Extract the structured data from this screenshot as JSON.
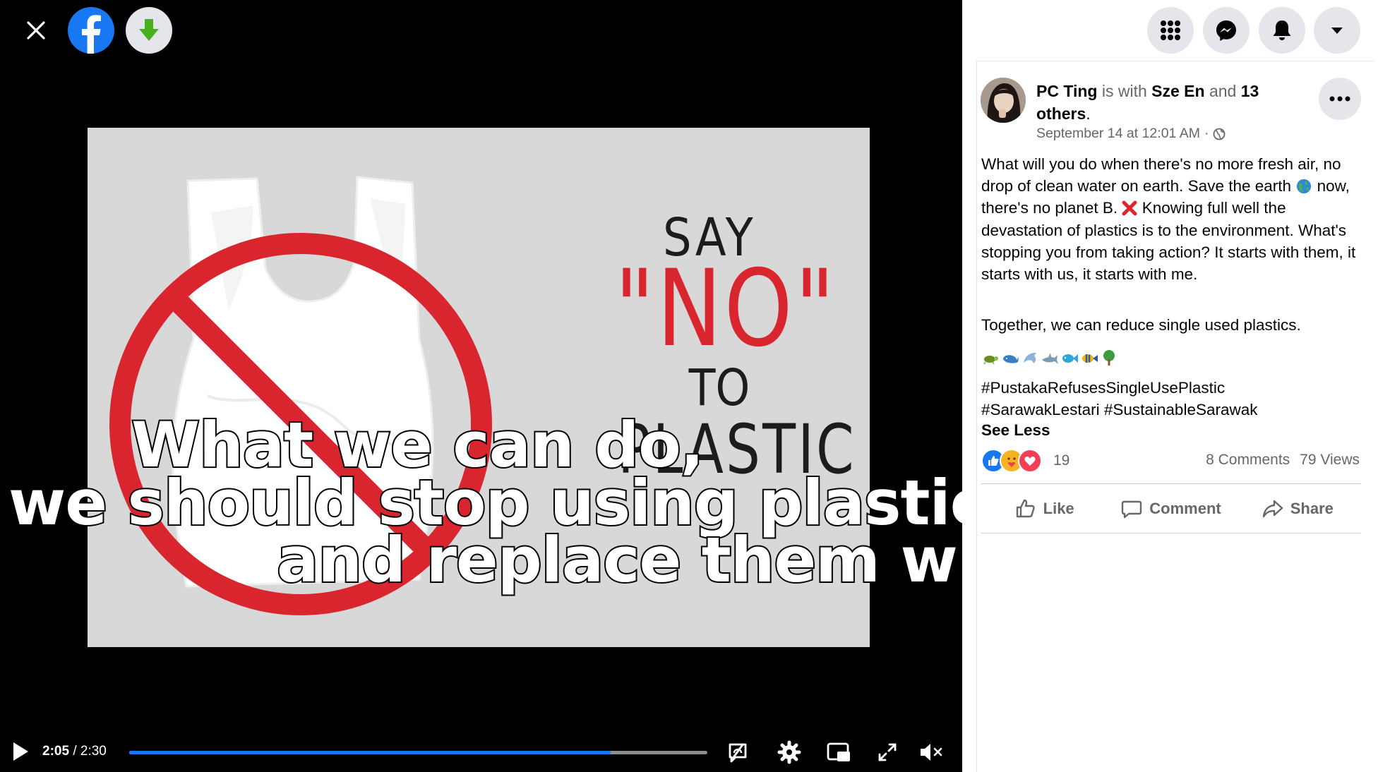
{
  "video": {
    "poster_text": {
      "say": "SAY",
      "no": "\"NO\"",
      "to": "TO",
      "plastic": "PLASTIC"
    },
    "captions": [
      "What we can do,",
      "we should stop using plastic bags",
      "and replace them with"
    ],
    "time_current": "2:05",
    "time_separator": "/",
    "time_total": "2:30",
    "progress_fraction": 0.833
  },
  "post": {
    "author": "PC Ting",
    "with_text": "is with",
    "tagged": "Sze En",
    "and_text": "and",
    "others": "13 others",
    "period": ".",
    "timestamp": "September 14 at 12:01 AM",
    "timestamp_sep": "·",
    "body_parts": {
      "a": "What will you do when there's no more fresh air, no drop of clean water on earth. Save the earth",
      "b": "now, there's no planet B.",
      "c": "Knowing full well the devastation of plastics is to the environment. What's stopping you from taking action? It starts with them, it starts with us, it starts with me."
    },
    "body2": "Together, we can reduce single used plastics.",
    "emojis": [
      "turtle",
      "whale",
      "dolphin",
      "shark",
      "fish",
      "tropical-fish",
      "tree"
    ],
    "hashtags": [
      "#PustakaRefusesSingleUsePlastic",
      "#SarawakLestari",
      "#SustainableSarawak"
    ],
    "see_less": "See Less",
    "reaction_count": "19",
    "comments": "8 Comments",
    "views": "79 Views",
    "actions": {
      "like": "Like",
      "comment": "Comment",
      "share": "Share"
    }
  },
  "colors": {
    "accent": "#1877f2",
    "no_red": "#d9262e",
    "muted": "#65676b"
  }
}
